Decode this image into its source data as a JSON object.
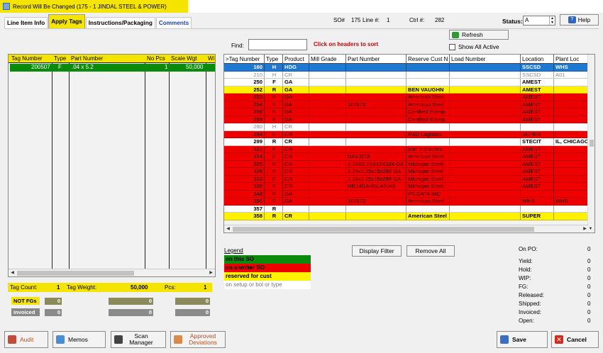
{
  "window": {
    "title": "Record Will Be Changed  (175 - 1    JINDAL STEEL & POWER)"
  },
  "tabs": [
    {
      "label": "Line Item Info"
    },
    {
      "label": "Apply Tags"
    },
    {
      "label": "Instructions/Packaging"
    },
    {
      "label": "Comments"
    }
  ],
  "header": {
    "so_label": "SO#",
    "so_value": "175",
    "line_label": "Line #:",
    "line_value": "1",
    "ctrl_label": "Ctrl #:",
    "ctrl_value": "282",
    "status_label": "Status:",
    "status_value": "A",
    "help_label": "Help"
  },
  "find": {
    "label": "Find:",
    "value": "",
    "hint": "Click on headers to sort"
  },
  "refresh_label": "Refresh",
  "show_all_label": "Show All Active",
  "left_grid": {
    "headers": [
      "Tag Number",
      "Type",
      "Part Number",
      "No Pcs",
      "Scale Wgt",
      "Wi"
    ],
    "row": {
      "tag": "200507",
      "type": "F",
      "part": ".04 x 5.2",
      "pcs": "1",
      "wgt": "50,000"
    }
  },
  "right_grid": {
    "headers": [
      ">Tag Number",
      "Type",
      "Product",
      "Mill Grade",
      "Part Number",
      "Reserve Cust N",
      "Load Number",
      "Location",
      "Plant Loc"
    ],
    "rows": [
      {
        "tag": "160",
        "type": "H",
        "product": "HDG",
        "mill": "",
        "part": "",
        "cust": "",
        "load": "",
        "loc": "SSCSD",
        "plant": "WHS",
        "bg": "#1f78d1",
        "fg": "#ffffff",
        "bold": true
      },
      {
        "tag": "210",
        "type": "H",
        "product": "CR",
        "mill": "",
        "part": "",
        "cust": "",
        "load": "",
        "loc": "SSCSD",
        "plant": "A01",
        "bg": "#ffffff",
        "fg": "#8c8c8c",
        "bold": false
      },
      {
        "tag": "250",
        "type": "F",
        "product": "GA",
        "mill": "",
        "part": "",
        "cust": "",
        "load": "",
        "loc": "AMEST",
        "plant": "",
        "bg": "#ffffff",
        "fg": "#000000",
        "bold": true
      },
      {
        "tag": "252",
        "type": "R",
        "product": "GA",
        "mill": "",
        "part": "",
        "cust": "BEN VAUGHN",
        "load": "",
        "loc": "AMEST",
        "plant": "",
        "bg": "#fff200",
        "fg": "#000000",
        "bold": true
      },
      {
        "tag": "253",
        "type": "F",
        "product": "GA",
        "mill": "",
        "part": "",
        "cust": "American Steel",
        "load": "",
        "loc": "AMEST",
        "plant": "",
        "bg": "#ee0000",
        "fg": "#2a0000",
        "bold": false
      },
      {
        "tag": "254",
        "type": "F",
        "product": "GA",
        "mill": "",
        "part": "100173",
        "cust": "American Steel",
        "load": "",
        "loc": "AMEST",
        "plant": "",
        "bg": "#ee0000",
        "fg": "#2a0000",
        "bold": false
      },
      {
        "tag": "258",
        "type": "F",
        "product": "GA",
        "mill": "",
        "part": "",
        "cust": "Certified Stamp",
        "load": "",
        "loc": "AMEST",
        "plant": "",
        "bg": "#ee0000",
        "fg": "#2a0000",
        "bold": false
      },
      {
        "tag": "259",
        "type": "F",
        "product": "GA",
        "mill": "",
        "part": "",
        "cust": "Certified Stamp",
        "load": "",
        "loc": "AMEST",
        "plant": "",
        "bg": "#ee0000",
        "fg": "#2a0000",
        "bold": false
      },
      {
        "tag": "280",
        "type": "H",
        "product": "CR",
        "mill": "",
        "part": "",
        "cust": "",
        "load": "",
        "loc": "",
        "plant": "",
        "bg": "#ffffff",
        "fg": "#8c8c8c",
        "bold": false
      },
      {
        "tag": "294",
        "type": "F",
        "product": "CR",
        "mill": "",
        "part": "",
        "cust": "R&D Logistics",
        "load": "",
        "loc": "SUPER",
        "plant": "",
        "bg": "#ee0000",
        "fg": "#2a0000",
        "bold": false
      },
      {
        "tag": "299",
        "type": "R",
        "product": "CR",
        "mill": "",
        "part": "",
        "cust": "",
        "load": "",
        "loc": "STECIT",
        "plant": "IL, CHICAGO",
        "bg": "#ffffff",
        "fg": "#000000",
        "bold": true
      },
      {
        "tag": "321",
        "type": "F",
        "product": "CR",
        "mill": "",
        "part": "",
        "cust": "Iron Industries",
        "load": "",
        "loc": "AMEST",
        "plant": "",
        "bg": "#ee0000",
        "fg": "#2a0000",
        "bold": false
      },
      {
        "tag": "324",
        "type": "F",
        "product": "CR",
        "mill": "",
        "part": "DA10215",
        "cust": "American Steel",
        "load": "",
        "loc": "AMEST",
        "plant": "",
        "bg": "#ee0000",
        "fg": "#2a0000",
        "bold": false
      },
      {
        "tag": "325",
        "type": "F",
        "product": "CR",
        "mill": "",
        "part": "2.25X2.25X13X324 GA",
        "cust": "Michigan Steel",
        "load": "",
        "loc": "AMEST",
        "plant": "",
        "bg": "#ee0000",
        "fg": "#2a0000",
        "bold": false
      },
      {
        "tag": "328",
        "type": "F",
        "product": "CR",
        "mill": "",
        "part": "2.25x2.25x15x288 GA",
        "cust": "Michigan Steel",
        "load": "",
        "loc": "AMEST",
        "plant": "",
        "bg": "#ee0000",
        "fg": "#2a0000",
        "bold": false
      },
      {
        "tag": "333",
        "type": "F",
        "product": "CR",
        "mill": "",
        "part": "2.25x2.25x15x288 GA",
        "cust": "Michigan Steel",
        "load": "",
        "loc": "AMEST",
        "plant": "",
        "bg": "#ee0000",
        "fg": "#2a0000",
        "bold": false
      },
      {
        "tag": "336",
        "type": "F",
        "product": "CR",
        "mill": "",
        "part": "HR14GAHSLA5048",
        "cust": "Michigan Steel",
        "load": "",
        "loc": "AMEST",
        "plant": "",
        "bg": "#ee0000",
        "fg": "#2a0000",
        "bold": false
      },
      {
        "tag": "348",
        "type": "F",
        "product": "GA",
        "mill": "",
        "part": "",
        "cust": "PS DATA INC",
        "load": "",
        "loc": "",
        "plant": "",
        "bg": "#ee0000",
        "fg": "#2a0000",
        "bold": false
      },
      {
        "tag": "350",
        "type": "F",
        "product": "GA",
        "mill": "",
        "part": "100172",
        "cust": "American Steel",
        "load": "",
        "loc": "WHS",
        "plant": "WHS",
        "bg": "#ee0000",
        "fg": "#2a0000",
        "bold": false
      },
      {
        "tag": "357",
        "type": "R",
        "product": "",
        "mill": "",
        "part": "",
        "cust": "",
        "load": "",
        "loc": "",
        "plant": "",
        "bg": "#ffffff",
        "fg": "#000000",
        "bold": true
      },
      {
        "tag": "358",
        "type": "R",
        "product": "CR",
        "mill": "",
        "part": "",
        "cust": "American Steel",
        "load": "",
        "loc": "SUPER",
        "plant": "",
        "bg": "#fff200",
        "fg": "#000000",
        "bold": true
      }
    ]
  },
  "legend": {
    "title": "Legend",
    "items": [
      {
        "label": "on this SO",
        "color": "#0c8a0c"
      },
      {
        "label": "on another SO",
        "color": "#ee0000"
      },
      {
        "label": "reserved for cust",
        "color": "#fff200"
      },
      {
        "label": "on setup or bol or type",
        "color": "#ffffff"
      }
    ]
  },
  "buttons": {
    "display_filter": "Display Filter",
    "remove_all": "Remove All"
  },
  "stats": [
    {
      "label": "On PO:",
      "value": "0"
    },
    {
      "label": "Yield:",
      "value": "0"
    },
    {
      "label": "Hold:",
      "value": "0"
    },
    {
      "label": "WIP:",
      "value": "0"
    },
    {
      "label": "FG:",
      "value": "0"
    },
    {
      "label": "Released:",
      "value": "0"
    },
    {
      "label": "Shipped:",
      "value": "0"
    },
    {
      "label": "Invoiced:",
      "value": "0"
    },
    {
      "label": "Open:",
      "value": "0"
    }
  ],
  "summary": {
    "tag_count_label": "Tag Count:",
    "tag_count": "1",
    "tag_weight_label": "Tag Weight:",
    "tag_weight": "50,000",
    "pcs_label": "Pcs:",
    "pcs": "1",
    "not_fgs_label": "NOT FGs",
    "not_fgs": [
      "0",
      "0",
      "0"
    ],
    "invoiced_label": "Invoiced",
    "invoiced": [
      "0",
      "0",
      "0"
    ]
  },
  "bottom_buttons": {
    "audit": "Audit",
    "memos": "Memos",
    "scan_manager": "Scan Manager",
    "approved_deviations": "Approved Deviations",
    "save": "Save",
    "cancel": "Cancel"
  }
}
